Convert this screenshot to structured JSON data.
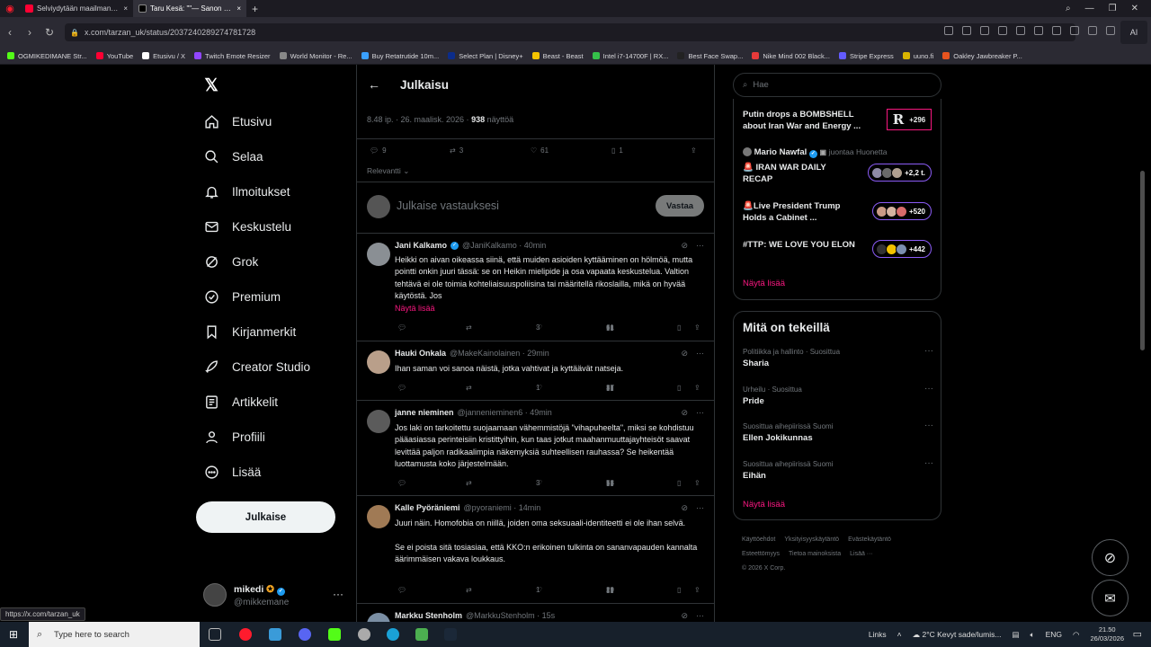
{
  "browser": {
    "tabs": [
      {
        "label": "Selviydytään maailman vaa",
        "color": "#ff0033"
      },
      {
        "label": "Taru Kesä: \"\"— Sanon nyt",
        "color": "#333333"
      }
    ],
    "url": "x.com/tarzan_uk/status/2037240289274781728",
    "ai_label": "AI",
    "bookmarks": [
      {
        "label": "OGMIKEDIMANE Str...",
        "color": "#53fc18"
      },
      {
        "label": "YouTube",
        "color": "#ff0033"
      },
      {
        "label": "Etusivu / X",
        "color": "#ffffff"
      },
      {
        "label": "Twitch Emote Resizer",
        "color": "#9146ff"
      },
      {
        "label": "World Monitor - Re...",
        "color": "#888888"
      },
      {
        "label": "Buy Retatrutide 10m...",
        "color": "#3aa0ff"
      },
      {
        "label": "Select Plan | Disney+",
        "color": "#0b2c8a"
      },
      {
        "label": "Beast - Beast",
        "color": "#f5c400"
      },
      {
        "label": "Intel i7-14700F | RX...",
        "color": "#35c14a"
      },
      {
        "label": "Best Face Swap...",
        "color": "#222222"
      },
      {
        "label": "Nike Mind 002 Black...",
        "color": "#e63a3a"
      },
      {
        "label": "Stripe Express",
        "color": "#635bff"
      },
      {
        "label": "uuno.fi",
        "color": "#d9b400"
      },
      {
        "label": "Oakley Jawbreaker P...",
        "color": "#e8541f"
      }
    ],
    "status_url": "https://x.com/tarzan_uk"
  },
  "nav": {
    "items": [
      {
        "label": "Etusivu",
        "icon": "home-icon"
      },
      {
        "label": "Selaa",
        "icon": "search-icon"
      },
      {
        "label": "Ilmoitukset",
        "icon": "bell-icon"
      },
      {
        "label": "Keskustelu",
        "icon": "mail-icon"
      },
      {
        "label": "Grok",
        "icon": "grok-icon"
      },
      {
        "label": "Premium",
        "icon": "premium-icon"
      },
      {
        "label": "Kirjanmerkit",
        "icon": "bookmark-icon"
      },
      {
        "label": "Creator Studio",
        "icon": "rocket-icon"
      },
      {
        "label": "Artikkelit",
        "icon": "article-icon"
      },
      {
        "label": "Profiili",
        "icon": "person-icon"
      },
      {
        "label": "Lisää",
        "icon": "more-circle-icon"
      }
    ],
    "post_button": "Julkaise",
    "account": {
      "name": "mikedi",
      "handle": "@mikkemane"
    }
  },
  "post": {
    "header_title": "Julkaisu",
    "time": "8.48 ip. · 26. maalisk. 2026 ·",
    "views_count": "938",
    "views_label": "näyttöä",
    "stats": {
      "replies": "9",
      "reposts": "3",
      "likes": "61",
      "bookmarks": "1"
    },
    "sort_label": "Relevantti",
    "reply_placeholder": "Julkaise vastauksesi",
    "reply_button": "Vastaa"
  },
  "replies": [
    {
      "name": "Jani Kalkamo",
      "handle": "@JaniKalkamo · 40min",
      "verified": true,
      "avatar_color": "#8a8f94",
      "text": "Heikki on aivan oikeassa siinä, että muiden asioiden kyttääminen on hölmöä, mutta pointti onkin juuri tässä: se on Heikin mielipide ja osa vapaata keskustelua. Valtion tehtävä ei ole toimia kohteliaisuuspoliisina tai määritellä rikoslailla, mikä on hyvää käytöstä. Jos",
      "show_more": "Näytä lisää",
      "stats": {
        "replies": "",
        "reposts": "",
        "likes": "3",
        "views": "61"
      }
    },
    {
      "name": "Hauki Onkala",
      "handle": "@MakeKainolainen · 29min",
      "verified": false,
      "avatar_color": "#b99f8a",
      "text": "Ihan saman voi sanoa näistä, jotka vahtivat ja kyttäävät natseja.",
      "show_more": "",
      "stats": {
        "replies": "",
        "reposts": "",
        "likes": "1",
        "views": "37"
      }
    },
    {
      "name": "janne nieminen",
      "handle": "@jannenieminen6 · 49min",
      "verified": false,
      "avatar_color": "#5b5b5b",
      "text": "Jos laki on tarkoitettu suojaamaan vähemmistöjä \"vihapuheelta\", miksi se kohdistuu pääasiassa perinteisiin kristittyihin, kun taas jotkut maahanmuuttajayhteisöt saavat levittää paljon radikaalimpia näkemyksiä suhteellisen rauhassa? Se heikentää luottamusta koko järjestelmään.",
      "show_more": "",
      "stats": {
        "replies": "",
        "reposts": "",
        "likes": "3",
        "views": "53"
      }
    },
    {
      "name": "Kalle Pyöräniemi",
      "handle": "@pyoraniemi · 14min",
      "verified": false,
      "avatar_color": "#a07a55",
      "text": "Juuri näin. Homofobia on niillä, joiden oma seksuaali-identiteetti ei ole ihan selvä.\n\nSe ei poista sitä tosiasiaa, että KKO:n erikoinen tulkinta on sananvapauden kannalta äärimmäisen vakava loukkaus.",
      "show_more": "",
      "stats": {
        "replies": "",
        "reposts": "",
        "likes": "1",
        "views": "29"
      }
    },
    {
      "name": "Markku Stenholm",
      "handle": "@MarkkuStenholm · 15s",
      "verified": false,
      "avatar_color": "#7a8ea3",
      "text": "",
      "show_more": "",
      "stats": {
        "replies": "",
        "reposts": "",
        "likes": "",
        "views": ""
      }
    }
  ],
  "sidebar": {
    "search_placeholder": "Hae",
    "live": [
      {
        "title": "Putin drops a BOMBSHELL about Iran War and Energy ...",
        "badge_letter": "R",
        "count": "+296"
      },
      {
        "host": "Mario Nawfal",
        "host_sub": "juontaa Huonetta",
        "title": "🚨 IRAN WAR DAILY RECAP",
        "count": "+2,2 t."
      },
      {
        "title": "🚨Live President Trump Holds a Cabinet ...",
        "count": "+520"
      },
      {
        "title": "#TTP: WE LOVE YOU ELON",
        "count": "+442"
      }
    ],
    "live_show_more": "Näytä lisää",
    "trends_title": "Mitä on tekeillä",
    "trends": [
      {
        "context": "Politiikka ja hallinto · Suosittua",
        "name": "Sharia"
      },
      {
        "context": "Urheilu · Suosittua",
        "name": "Pride"
      },
      {
        "context": "Suosittua aihepiirissä Suomi",
        "name": "Ellen Jokikunnas"
      },
      {
        "context": "Suosittua aihepiirissä Suomi",
        "name": "Eihän"
      }
    ],
    "trends_show_more": "Näytä lisää",
    "footer": [
      "Käyttöehdot",
      "Yksityisyyskäytäntö",
      "Evästekäytäntö",
      "Esteettömyys",
      "Tietoa mainoksista",
      "Lisää ···",
      "© 2026 X Corp."
    ]
  },
  "taskbar": {
    "search_placeholder": "Type here to search",
    "links_label": "Links",
    "weather": "2°C  Kevyt sade/lumis...",
    "lang": "ENG",
    "time": "21.50",
    "date": "26/03/2026"
  }
}
